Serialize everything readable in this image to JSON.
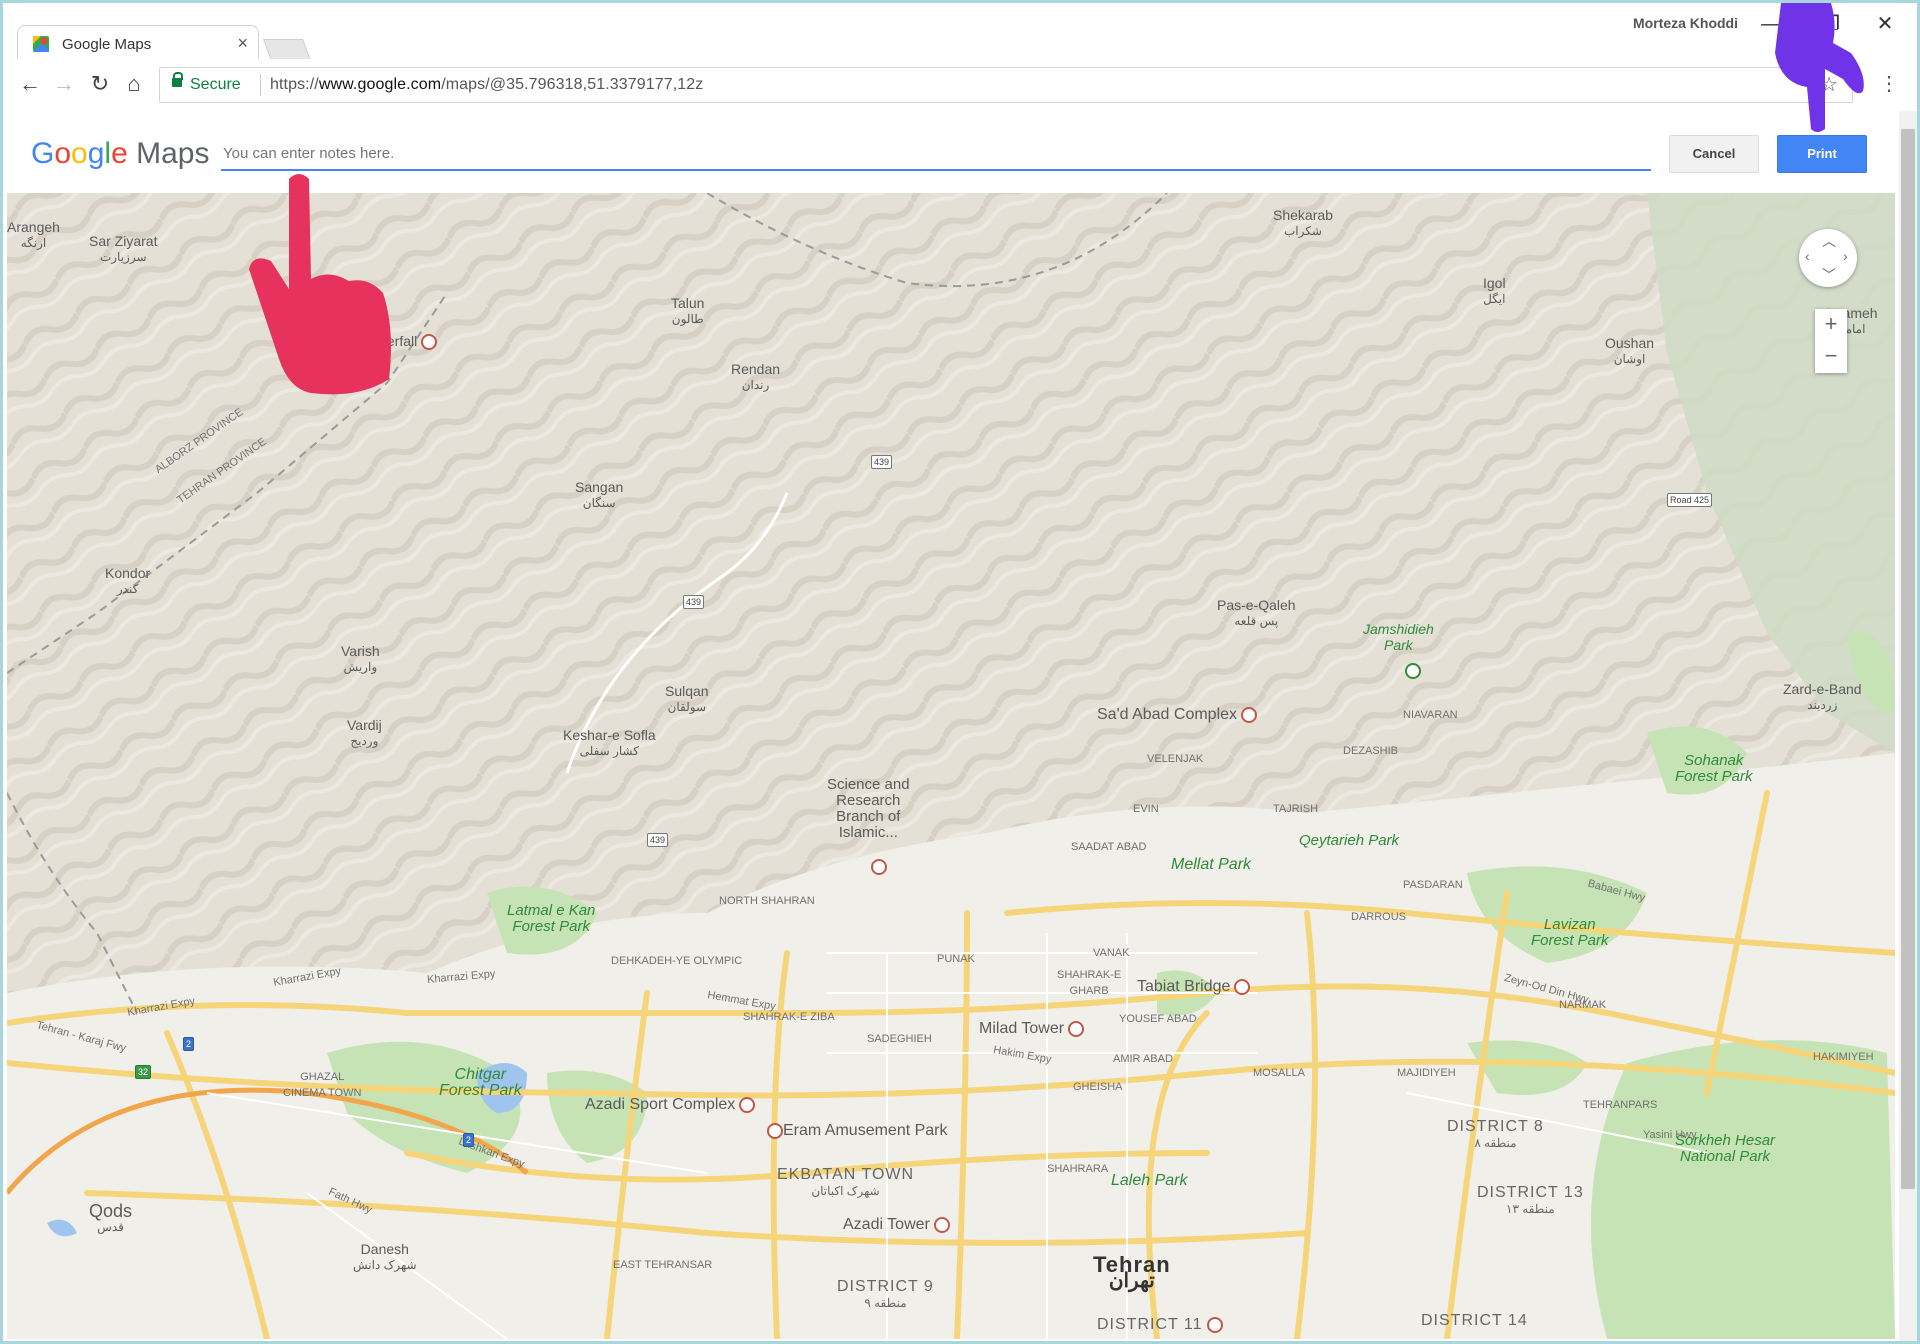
{
  "browser": {
    "tab_title": "Google Maps",
    "tab_close": "×",
    "username": "Morteza Khoddi",
    "window_minimize": "—",
    "window_maximize": "❐",
    "window_close": "✕",
    "back": "←",
    "forward": "→",
    "reload": "↻",
    "home": "⌂",
    "secure_label": "Secure",
    "url_scheme": "https://",
    "url_host": "www.google.com",
    "url_path": "/maps/@35.796318,51.3379177,12z",
    "bookmark": "☆",
    "menu": "⋮"
  },
  "print_header": {
    "logo_google": "Google",
    "logo_maps": "Maps",
    "notes_placeholder": "You can enter notes here.",
    "cancel_label": "Cancel",
    "print_label": "Print"
  },
  "map_controls": {
    "zoom_in": "+",
    "zoom_out": "−"
  },
  "map": {
    "labels": {
      "arangeh": "Arangeh",
      "arangeh_fa": "ارنگه",
      "sar_ziyarat": "Sar Ziyarat",
      "sar_ziyarat_fa": "سرزیارت",
      "waterfall": "terfall",
      "talun": "Talun",
      "talun_fa": "طالون",
      "rendan": "Rendan",
      "rendan_fa": "رندان",
      "shekarab": "Shekarab",
      "shekarab_fa": "شکراب",
      "igol": "Igol",
      "igol_fa": "ایگل",
      "imameh": "Imameh",
      "imameh_fa": "امامه",
      "oushan": "Oushan",
      "oushan_fa": "اوشان",
      "sangan": "Sangan",
      "sangan_fa": "سنگان",
      "kondor": "Kondor",
      "kondor_fa": "کندر",
      "varish": "Varish",
      "varish_fa": "واریش",
      "vardij": "Vardij",
      "vardij_fa": "وردیج",
      "sulqan": "Sulqan",
      "sulqan_fa": "سولقان",
      "keshar": "Keshar-e Sofla",
      "keshar_fa": "کشار سفلی",
      "pas_e_qaleh": "Pas-e-Qaleh",
      "pas_e_qaleh_fa": "پس قلعه",
      "jamshidieh": "Jamshidieh\nPark",
      "zard_e_band": "Zard-e-Band",
      "zard_e_band_fa": "زردبند",
      "saad_abad": "Sa'd Abad Complex",
      "science": "Science and\nResearch\nBranch of\nIslamic...",
      "sohanak": "Sohanak\nForest Park",
      "qeytarieh": "Qeytarieh Park",
      "mellat": "Mellat Park",
      "latmal": "Latmal e Kan\nForest Park",
      "lavizan": "Lavizan\nForest Park",
      "tabiat": "Tabiat Bridge",
      "milad": "Milad Tower",
      "chitgar": "Chitgar\nForest Park",
      "azadi_sport": "Azadi Sport Complex",
      "eram": "Eram Amusement Park",
      "ekbatan": "EKBATAN TOWN",
      "ekbatan_fa": "شهرک اکباتان",
      "azadi_tower": "Azadi Tower",
      "laleh": "Laleh Park",
      "district8": "DISTRICT 8",
      "district8_fa": "منطقه ۸",
      "district13": "DISTRICT 13",
      "district13_fa": "منطقه ۱۳",
      "sorkheh": "Sorkheh Hesar\nNational Park",
      "qods": "Qods",
      "qods_fa": "قدس",
      "danesh": "Danesh",
      "danesh_fa": "شهرک دانش",
      "district9": "DISTRICT 9",
      "district9_fa": "منطقه ۹",
      "tehran": "Tehran",
      "tehran_fa": "تهران",
      "district11": "DISTRICT 11",
      "district14": "DISTRICT 14",
      "alborz_province": "ALBORZ PROVINCE",
      "tehran_province": "TEHRAN PROVINCE",
      "kharrazi1": "Kharrazi Expy",
      "kharrazi2": "Kharrazi Expy",
      "tehran_karaj": "Tehran - Karaj Fwy",
      "hemmat": "Hemmat Expy",
      "niyayesh": "Niayesh Expy",
      "hakim": "Hakim Expy",
      "babaei": "Babaei Hwy",
      "lashkari": "Lashkari Expy",
      "fath": "Fath Hwy",
      "zeyn": "Zeyn-Od Din Hwy",
      "yasini": "Yasini Hwy",
      "shahid_kharrazi": "Kharrazi Expy",
      "r439a": "439",
      "r439b": "439",
      "r439c": "439",
      "road425": "Road 425",
      "r2a": "2",
      "r2b": "2",
      "r32": "32",
      "velenjak": "VELENJAK",
      "evin": "EVIN",
      "dezashib": "DEZASHIB",
      "niavaran": "NIAVARAN",
      "tajrish": "TAJRISH",
      "saadat_abad": "SAADAT ABAD",
      "pasdaran": "PASDARAN",
      "darrous": "DARROUS",
      "vanak": "VANAK",
      "shahrak_gharb": "SHAHRAK-E\nGHARB",
      "sadeghieh": "SADEGHIEH",
      "yousef_abad": "YOUSEF ABAD",
      "amir_abad": "AMIR ABAD",
      "mosalla": "MOSALLA",
      "majidiyeh": "MAJIDIYEH",
      "narmak": "NARMAK",
      "tehranpars": "TEHRANPARS",
      "hakimiyeh": "HAKIMIYEH",
      "shahrara": "SHAHRARA",
      "east_tehransar": "EAST TEHRANSAR",
      "gheisha": "GHEISHA",
      "ghazal": "GHAZAL\nCINEMA TOWN",
      "north_shahran": "NORTH SHAHRAN",
      "dehkadeh": "DEHKADEH-YE OLYMPIC",
      "punak": "PUNAK",
      "sharak_ziba": "SHAHRAK-E ZIBA",
      "saadat_abad2": "SAADAT ABAD"
    }
  }
}
